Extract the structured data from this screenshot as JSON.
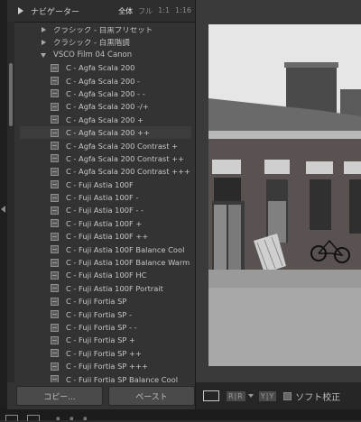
{
  "navigator": {
    "title": "ナビゲーター",
    "modes": [
      "全体",
      "フル",
      "1:1",
      "1:16"
    ],
    "active_mode": "全体"
  },
  "presets": {
    "folders_above": [
      "クラシック - 白黒プリセット",
      "クラシック - 白黒階調"
    ],
    "open_folder": "VSCO Film 04 Canon",
    "items": [
      "C - Agfa Scala 200",
      "C - Agfa Scala 200 -",
      "C - Agfa Scala 200 - -",
      "C - Agfa Scala 200 -/+",
      "C - Agfa Scala 200 +",
      "C - Agfa Scala 200 ++",
      "C - Agfa Scala 200 Contrast +",
      "C - Agfa Scala 200 Contrast ++",
      "C - Agfa Scala 200 Contrast +++",
      "C - Fuji Astia 100F",
      "C - Fuji Astia 100F -",
      "C - Fuji Astia 100F - -",
      "C - Fuji Astia 100F +",
      "C - Fuji Astia 100F ++",
      "C - Fuji Astia 100F Balance Cool",
      "C - Fuji Astia 100F Balance Warm",
      "C - Fuji Astia 100F HC",
      "C - Fuji Astia 100F Portrait",
      "C - Fuji Fortia SP",
      "C - Fuji Fortia SP -",
      "C - Fuji Fortia SP - -",
      "C - Fuji Fortia SP +",
      "C - Fuji Fortia SP ++",
      "C - Fuji Fortia SP +++",
      "C - Fuji Fortia SP Balance Cool"
    ],
    "highlighted_index": 5
  },
  "buttons": {
    "copy": "コピー...",
    "paste": "ペースト"
  },
  "toolbar": {
    "before_after": "R|R",
    "yy": "Y|Y",
    "soft_proof": "ソフト校正"
  },
  "colors": {
    "panel_bg": "#333333",
    "highlight_bg": "#3c3c3c"
  }
}
